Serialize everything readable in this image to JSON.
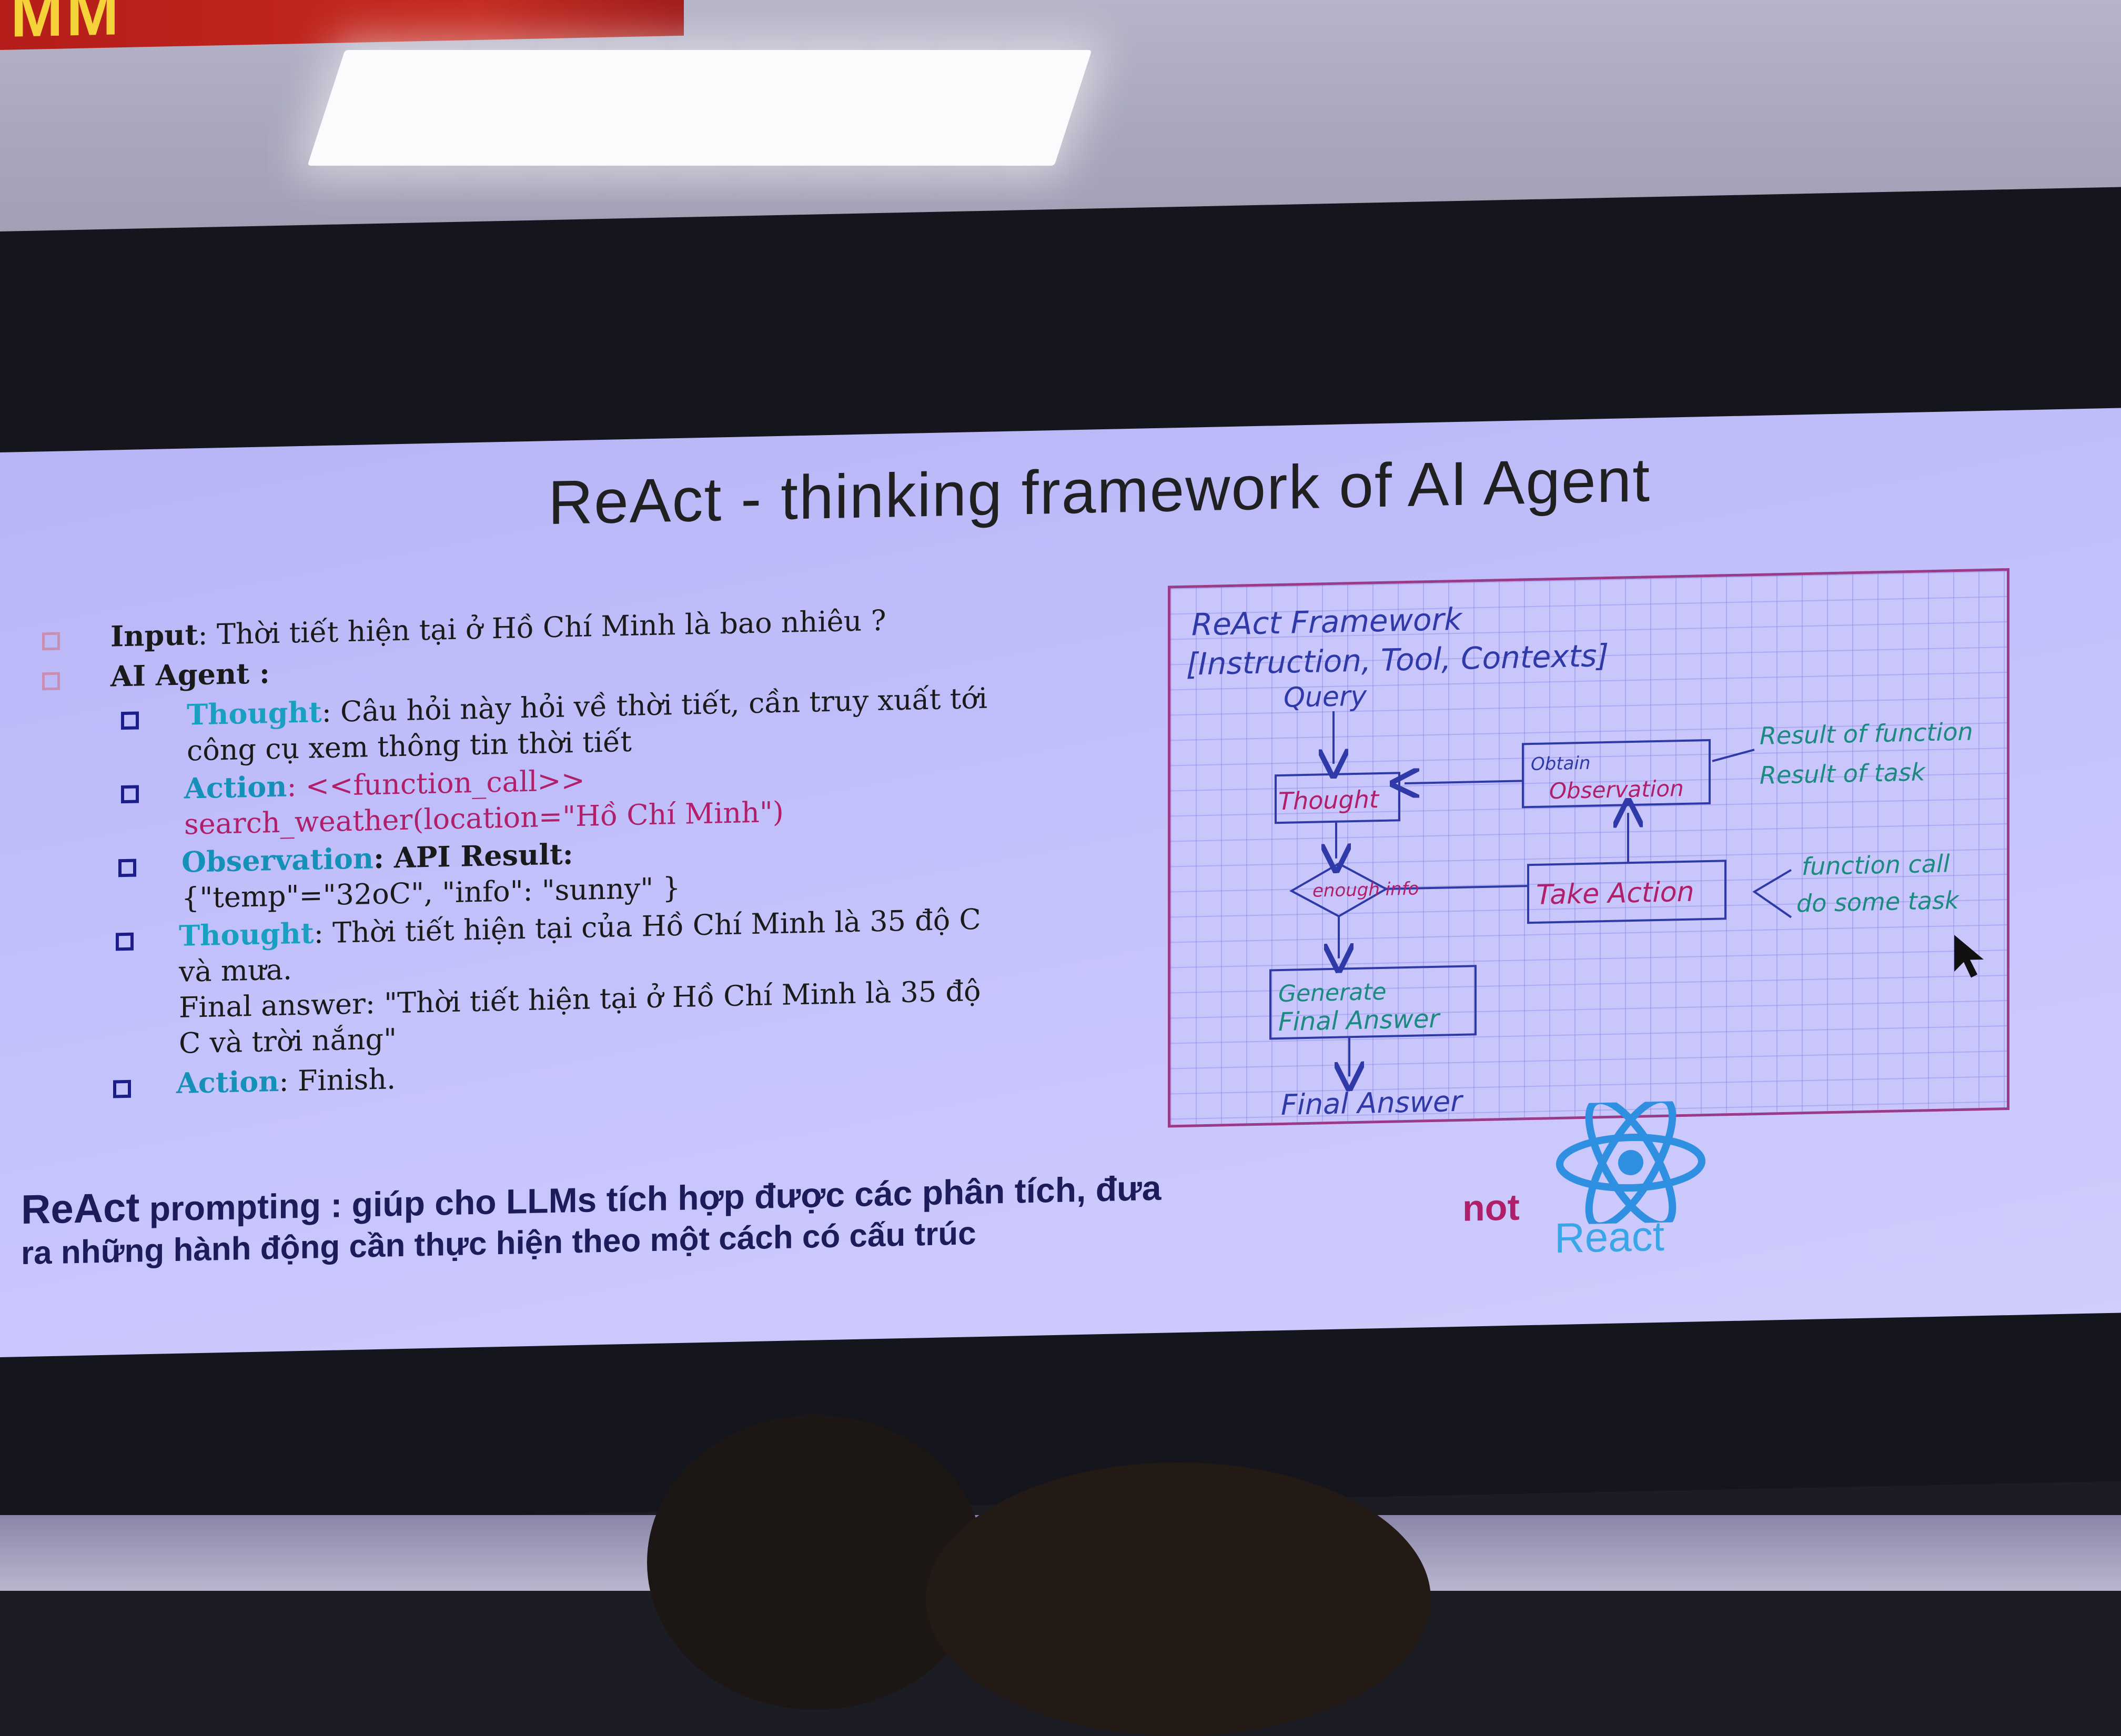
{
  "slide": {
    "title": "ReAct - thinking framework of AI Agent",
    "bullets": {
      "input_label": "Input",
      "input_text": ": Thời tiết hiện tại ở Hồ Chí Minh là bao nhiêu ?",
      "agent_label": "AI Agent :",
      "thought1_label": "Thought",
      "thought1_line1": ": Câu hỏi này hỏi về thời tiết, cần truy xuất tới",
      "thought1_line2": "công cụ xem thông tin thời tiết",
      "action1_label": "Action",
      "action1_line1": ": <<function_call>>",
      "action1_line2": "search_weather(location=\"Hồ Chí Minh\")",
      "obs_label": "Observation",
      "obs_line1": ": API Result:",
      "obs_line2": "{\"temp\"=\"32oC\", \"info\": \"sunny\" }",
      "thought2_label": "Thought",
      "thought2_line1": ": Thời tiết hiện tại của Hồ Chí Minh là 35 độ C",
      "thought2_line2": "và mưa.",
      "final_line1": "Final answer: \"Thời tiết hiện tại ở Hồ Chí Minh là 35 độ",
      "final_line2": "C và trời nắng\"",
      "action2_label": "Action",
      "action2_text": ": Finish."
    },
    "diagram": {
      "title": "ReAct Framework",
      "inputs": "[Instruction, Tool, Contexts]",
      "query": "Query",
      "thought": "Thought",
      "observation_top": "Obtain",
      "observation": "Observation",
      "enough": "enough info",
      "take_action": "Take Action",
      "generate": "Generate",
      "final_box": "Final Answer",
      "final_out": "Final Answer",
      "note_result1": "Result of function",
      "note_result2": "Result of task",
      "note_call1": "function call",
      "note_call2": "do some task"
    },
    "footer": {
      "react_word": "ReAct",
      "line1_rest": " prompting : giúp cho LLMs tích hợp được các phân tích, đưa",
      "line2": "ra những hành động cần thực hiện theo một cách có cấu trúc",
      "not_word": "not",
      "react_logo_text": "React"
    }
  },
  "environment": {
    "banner_text": "MM"
  },
  "colors": {
    "slide_bg": "#c3c1fb",
    "label_cyan": "#19a0c0",
    "code_pink": "#b0206a",
    "diagram_border": "#9b3a86",
    "react_blue": "#3aa6e8"
  }
}
